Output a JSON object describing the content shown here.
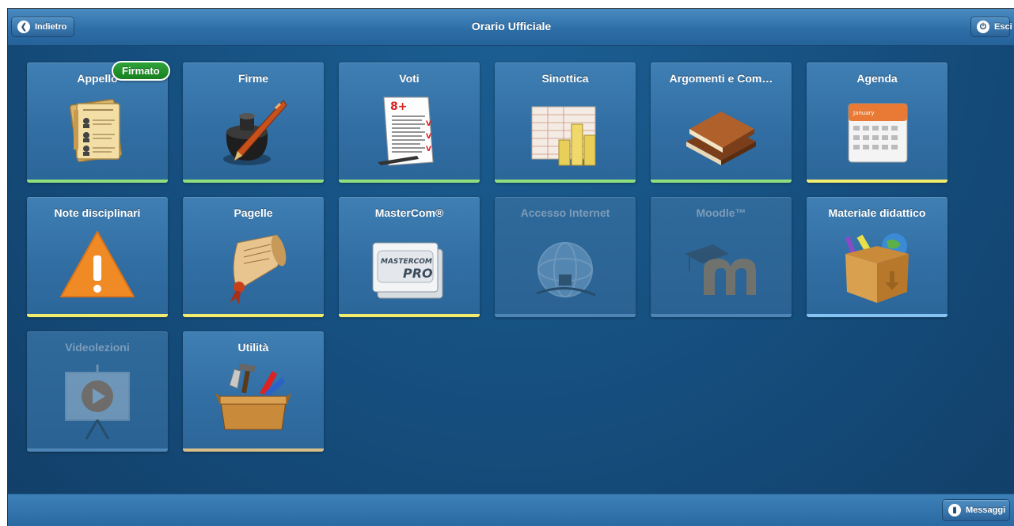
{
  "header": {
    "title": "Orario Ufficiale",
    "back_label": "Indietro",
    "exit_label": "Esci"
  },
  "badge": {
    "label": "Firmato",
    "color": "#1e8c27"
  },
  "tiles": [
    {
      "label": "Appello",
      "icon": "register-icon",
      "bar_color": "#8ee07e",
      "enabled": true
    },
    {
      "label": "Firme",
      "icon": "inkwell-pen-icon",
      "bar_color": "#8ee07e",
      "enabled": true
    },
    {
      "label": "Voti",
      "icon": "graded-paper-icon",
      "bar_color": "#8ee07e",
      "enabled": true
    },
    {
      "label": "Sinottica",
      "icon": "spreadsheet-chart-icon",
      "bar_color": "#8ee07e",
      "enabled": true
    },
    {
      "label": "Argomenti e Com…",
      "icon": "books-icon",
      "bar_color": "#8ee07e",
      "enabled": true
    },
    {
      "label": "Agenda",
      "icon": "calendar-icon",
      "bar_color": "#f2ec6e",
      "enabled": true
    },
    {
      "label": "Note disciplinari",
      "icon": "warning-icon",
      "bar_color": "#f2ec6e",
      "enabled": true
    },
    {
      "label": "Pagelle",
      "icon": "scroll-icon",
      "bar_color": "#f2ec6e",
      "enabled": true
    },
    {
      "label": "MasterCom®",
      "icon": "mastercom-pro-icon",
      "bar_color": "#f2ec6e",
      "enabled": true,
      "logo_line1": "MASTERCOM",
      "logo_line2": "PRO"
    },
    {
      "label": "Accesso Internet",
      "icon": "globe-network-icon",
      "bar_color": "#4d86b6",
      "enabled": false
    },
    {
      "label": "Moodle™",
      "icon": "moodle-icon",
      "bar_color": "#4d86b6",
      "enabled": false
    },
    {
      "label": "Materiale didattico",
      "icon": "box-materials-icon",
      "bar_color": "#84c3f4",
      "enabled": true
    },
    {
      "label": "Videolezioni",
      "icon": "projector-play-icon",
      "bar_color": "#4d86b6",
      "enabled": false
    },
    {
      "label": "Utilità",
      "icon": "toolbox-icon",
      "bar_color": "#d9c08a",
      "enabled": true
    }
  ],
  "footer": {
    "messages_label": "Messaggi"
  }
}
